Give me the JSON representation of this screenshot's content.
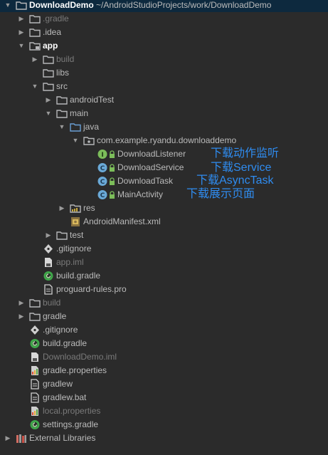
{
  "colors": {
    "background": "#2b2b2b",
    "text": "#bbbbbb",
    "excluded_text": "#7a7a7a",
    "annotation": "#2f8cf0",
    "folder": "#b6b7b9",
    "java_folder": "#6a9fd4",
    "class_icon": "#6aa9d7",
    "interface_icon": "#7cbd5a"
  },
  "rows": [
    {
      "label": "DownloadDemo",
      "suffix": " ~/AndroidStudioProjects/work/DownloadDemo",
      "icon": "folder-icon"
    },
    {
      "label": ".gradle",
      "icon": "folder-icon"
    },
    {
      "label": ".idea",
      "icon": "folder-icon"
    },
    {
      "label": "app",
      "icon": "module-folder-icon"
    },
    {
      "label": "build",
      "icon": "folder-icon"
    },
    {
      "label": "libs",
      "icon": "folder-icon"
    },
    {
      "label": "src",
      "icon": "folder-icon"
    },
    {
      "label": "androidTest",
      "icon": "folder-icon"
    },
    {
      "label": "main",
      "icon": "folder-icon"
    },
    {
      "label": "java",
      "icon": "source-folder-icon"
    },
    {
      "label": "com.example.ryandu.downloaddemo",
      "icon": "package-icon"
    },
    {
      "label": "DownloadListener",
      "icon": "interface-icon",
      "annotation": "下载动作监听"
    },
    {
      "label": "DownloadService",
      "icon": "class-icon",
      "annotation": "下载Service"
    },
    {
      "label": "DownloadTask",
      "icon": "class-icon",
      "annotation": "下载AsyncTask"
    },
    {
      "label": "MainActivity",
      "icon": "class-icon",
      "annotation": "下载展示页面"
    },
    {
      "label": "res",
      "icon": "resource-folder-icon"
    },
    {
      "label": "AndroidManifest.xml",
      "icon": "manifest-file-icon"
    },
    {
      "label": "test",
      "icon": "folder-icon"
    },
    {
      "label": ".gitignore",
      "icon": "git-file-icon"
    },
    {
      "label": "app.iml",
      "icon": "iml-file-icon"
    },
    {
      "label": "build.gradle",
      "icon": "gradle-file-icon"
    },
    {
      "label": "proguard-rules.pro",
      "icon": "text-file-icon"
    },
    {
      "label": "build",
      "icon": "folder-icon"
    },
    {
      "label": "gradle",
      "icon": "folder-icon"
    },
    {
      "label": ".gitignore",
      "icon": "git-file-icon"
    },
    {
      "label": "build.gradle",
      "icon": "gradle-file-icon"
    },
    {
      "label": "DownloadDemo.iml",
      "icon": "iml-file-icon"
    },
    {
      "label": "gradle.properties",
      "icon": "properties-file-icon"
    },
    {
      "label": "gradlew",
      "icon": "text-file-icon"
    },
    {
      "label": "gradlew.bat",
      "icon": "text-file-icon"
    },
    {
      "label": "local.properties",
      "icon": "properties-file-icon"
    },
    {
      "label": "settings.gradle",
      "icon": "gradle-file-icon"
    },
    {
      "label": "External Libraries",
      "icon": "libraries-icon"
    }
  ]
}
